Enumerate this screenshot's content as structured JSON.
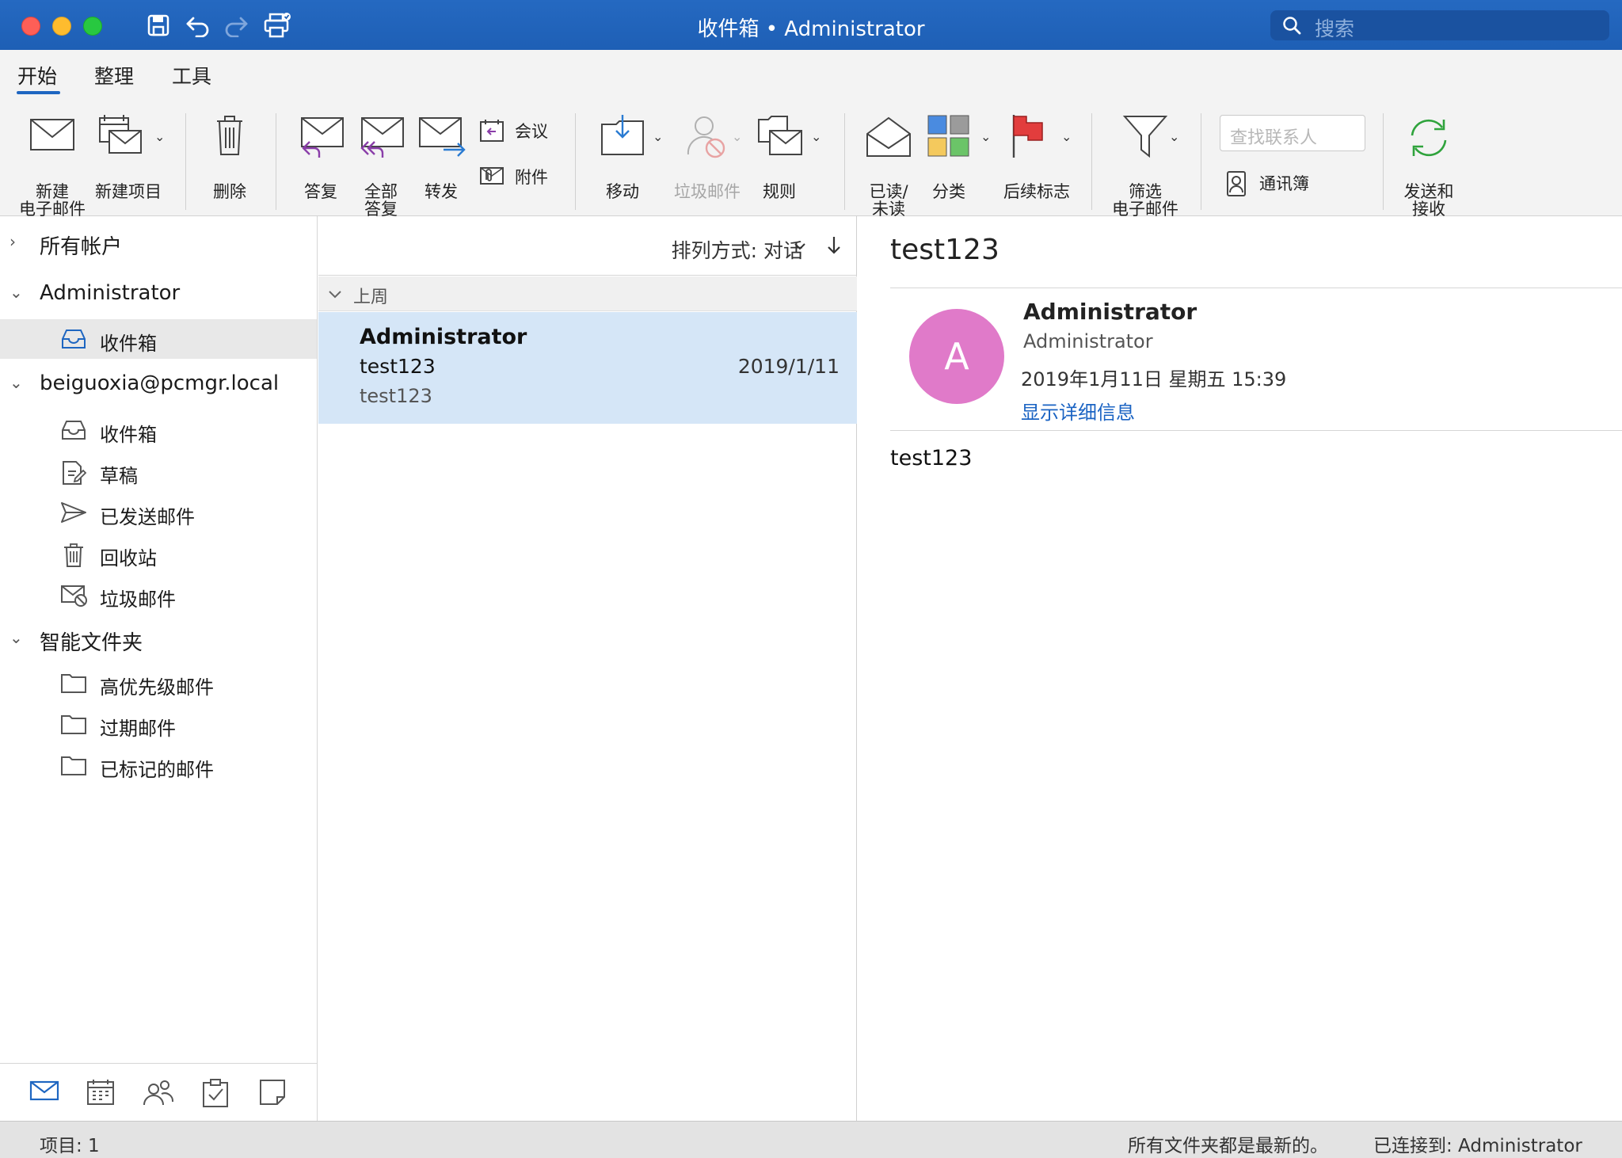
{
  "window": {
    "title": "收件箱 • Administrator",
    "search_placeholder": "搜索"
  },
  "ribbon": {
    "tabs": [
      {
        "label": "开始",
        "active": true
      },
      {
        "label": "整理",
        "active": false
      },
      {
        "label": "工具",
        "active": false
      }
    ],
    "new_email": "新建\n电子邮件",
    "new_item": "新建项目",
    "delete": "删除",
    "reply": "答复",
    "reply_all": "全部\n答复",
    "forward": "转发",
    "meeting": "会议",
    "attachment": "附件",
    "move": "移动",
    "junk": "垃圾邮件",
    "rules": "规则",
    "read_unread": "已读/\n未读",
    "categorize": "分类",
    "follow_up": "后续标志",
    "filter_email": "筛选\n电子邮件",
    "find_contact_placeholder": "查找联系人",
    "address_book": "通讯簿",
    "send_receive": "发送和\n接收"
  },
  "folders": {
    "all_accounts": "所有帐户",
    "admin_account": "Administrator",
    "admin_inbox": "收件箱",
    "second_account": "beiguoxia@pcmgr.local",
    "items": [
      {
        "label": "收件箱",
        "icon": "inbox-icon"
      },
      {
        "label": "草稿",
        "icon": "drafts-icon"
      },
      {
        "label": "已发送邮件",
        "icon": "sent-icon"
      },
      {
        "label": "回收站",
        "icon": "trash-icon"
      },
      {
        "label": "垃圾邮件",
        "icon": "junk-icon"
      }
    ],
    "smart_folders": "智能文件夹",
    "smart_items": [
      {
        "label": "高优先级邮件"
      },
      {
        "label": "过期邮件"
      },
      {
        "label": "已标记的邮件"
      }
    ]
  },
  "message_list": {
    "sort_label": "排列方式: 对话",
    "group_header": "上周",
    "messages": [
      {
        "from": "Administrator",
        "subject": "test123",
        "date": "2019/1/11",
        "preview": "test123"
      }
    ]
  },
  "reading_pane": {
    "subject": "test123",
    "avatar_letter": "A",
    "from_name": "Administrator",
    "to": "Administrator",
    "date": "2019年1月11日 星期五 15:39",
    "details_link": "显示详细信息",
    "body": "test123"
  },
  "status": {
    "items": "项目: 1",
    "up_to_date": "所有文件夹都是最新的。",
    "connected": "已连接到: Administrator"
  },
  "colors": {
    "titlebar": "#1e5fb5",
    "accent": "#1e66c1",
    "selected_message": "#d5e6f7",
    "avatar": "#e07ac9"
  }
}
